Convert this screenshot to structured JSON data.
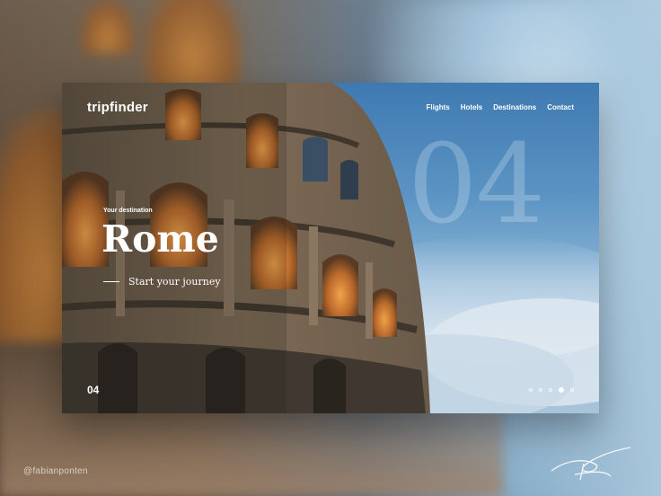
{
  "brand": {
    "logo": "tripfinder"
  },
  "nav": [
    {
      "label": "Flights"
    },
    {
      "label": "Hotels"
    },
    {
      "label": "Destinations"
    },
    {
      "label": "Contact"
    }
  ],
  "hero": {
    "slide_number_large": "04",
    "subtitle": "Your destination",
    "title": "Rome",
    "cta": "Start your journey"
  },
  "footer": {
    "page_number": "04",
    "pagination": {
      "total": 5,
      "active_index": 4
    }
  },
  "credit": "@fabianponten",
  "colors": {
    "sky": "#5c95c4",
    "stone": "#6b5a47",
    "warm_light": "#d48a3a",
    "text": "#ffffff"
  }
}
